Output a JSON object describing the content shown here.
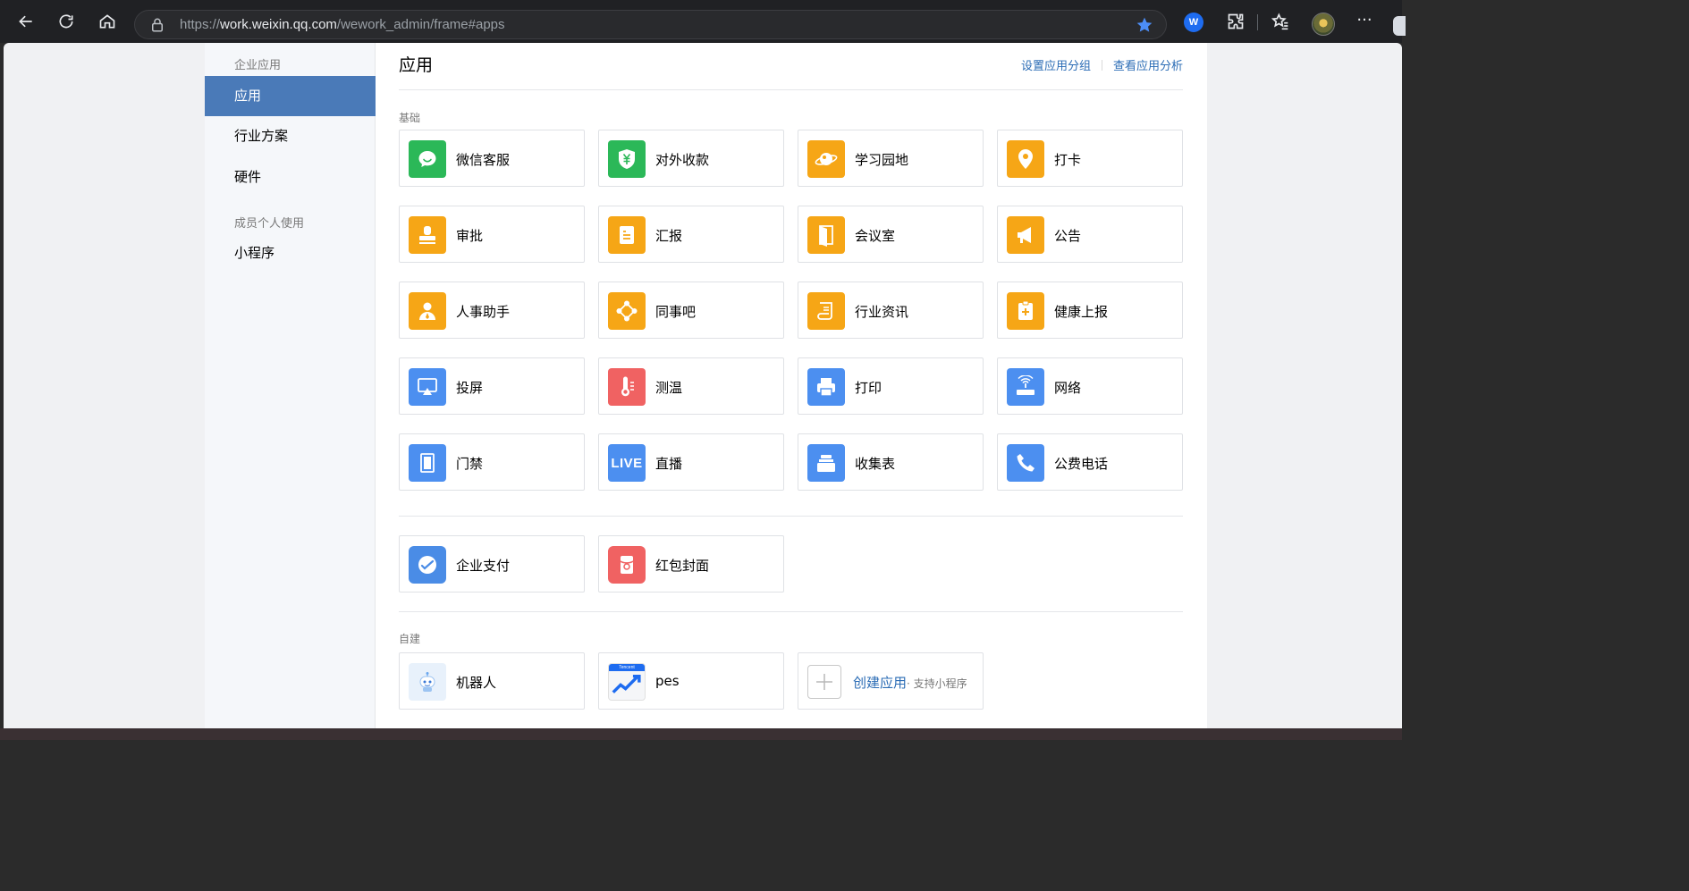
{
  "browser": {
    "url_prefix": "https://",
    "url_host": "work.weixin.qq.com",
    "url_path": "/wework_admin/frame#apps"
  },
  "sidebar": {
    "group1": "企业应用",
    "items": [
      {
        "label": "应用",
        "active": true
      },
      {
        "label": "行业方案",
        "active": false
      },
      {
        "label": "硬件",
        "active": false
      }
    ],
    "group2": "成员个人使用",
    "items2": [
      {
        "label": "小程序"
      }
    ]
  },
  "header": {
    "title": "应用",
    "link_group": "设置应用分组",
    "link_analysis": "查看应用分析"
  },
  "sections": {
    "basic_label": "基础",
    "custom_label": "自建"
  },
  "apps": {
    "basic": [
      {
        "name": "微信客服",
        "icon": "wechat-service-icon",
        "color": "green"
      },
      {
        "name": "对外收款",
        "icon": "yuan-shield-icon",
        "color": "green"
      },
      {
        "name": "学习园地",
        "icon": "planet-icon",
        "color": "orange"
      },
      {
        "name": "打卡",
        "icon": "location-pin-icon",
        "color": "orange"
      },
      {
        "name": "审批",
        "icon": "stamp-icon",
        "color": "orange"
      },
      {
        "name": "汇报",
        "icon": "report-icon",
        "color": "orange"
      },
      {
        "name": "会议室",
        "icon": "door-icon",
        "color": "orange"
      },
      {
        "name": "公告",
        "icon": "megaphone-icon",
        "color": "orange"
      },
      {
        "name": "人事助手",
        "icon": "person-icon",
        "color": "orange"
      },
      {
        "name": "同事吧",
        "icon": "network-icon",
        "color": "orange"
      },
      {
        "name": "行业资讯",
        "icon": "scroll-icon",
        "color": "orange"
      },
      {
        "name": "健康上报",
        "icon": "health-clipboard-icon",
        "color": "orange"
      },
      {
        "name": "投屏",
        "icon": "screen-cast-icon",
        "color": "blue"
      },
      {
        "name": "测温",
        "icon": "thermometer-icon",
        "color": "red"
      },
      {
        "name": "打印",
        "icon": "printer-icon",
        "color": "blue"
      },
      {
        "name": "网络",
        "icon": "router-icon",
        "color": "blue"
      },
      {
        "name": "门禁",
        "icon": "access-door-icon",
        "color": "blue"
      },
      {
        "name": "直播",
        "icon": "live-icon",
        "color": "blue"
      },
      {
        "name": "收集表",
        "icon": "collect-box-icon",
        "color": "blue"
      },
      {
        "name": "公费电话",
        "icon": "phone-icon",
        "color": "blue"
      }
    ],
    "payment": [
      {
        "name": "企业支付",
        "icon": "wepay-icon",
        "color": "paleblue"
      },
      {
        "name": "红包封面",
        "icon": "red-packet-icon",
        "color": "red"
      }
    ],
    "custom": [
      {
        "name": "机器人",
        "icon": "robot-icon"
      },
      {
        "name": "pes",
        "icon": "pes-chart-icon",
        "badge": "Tencent"
      }
    ],
    "create": {
      "label": "创建应用",
      "sub": "· 支持小程序"
    }
  },
  "icons": {
    "live_text": "LIVE"
  }
}
